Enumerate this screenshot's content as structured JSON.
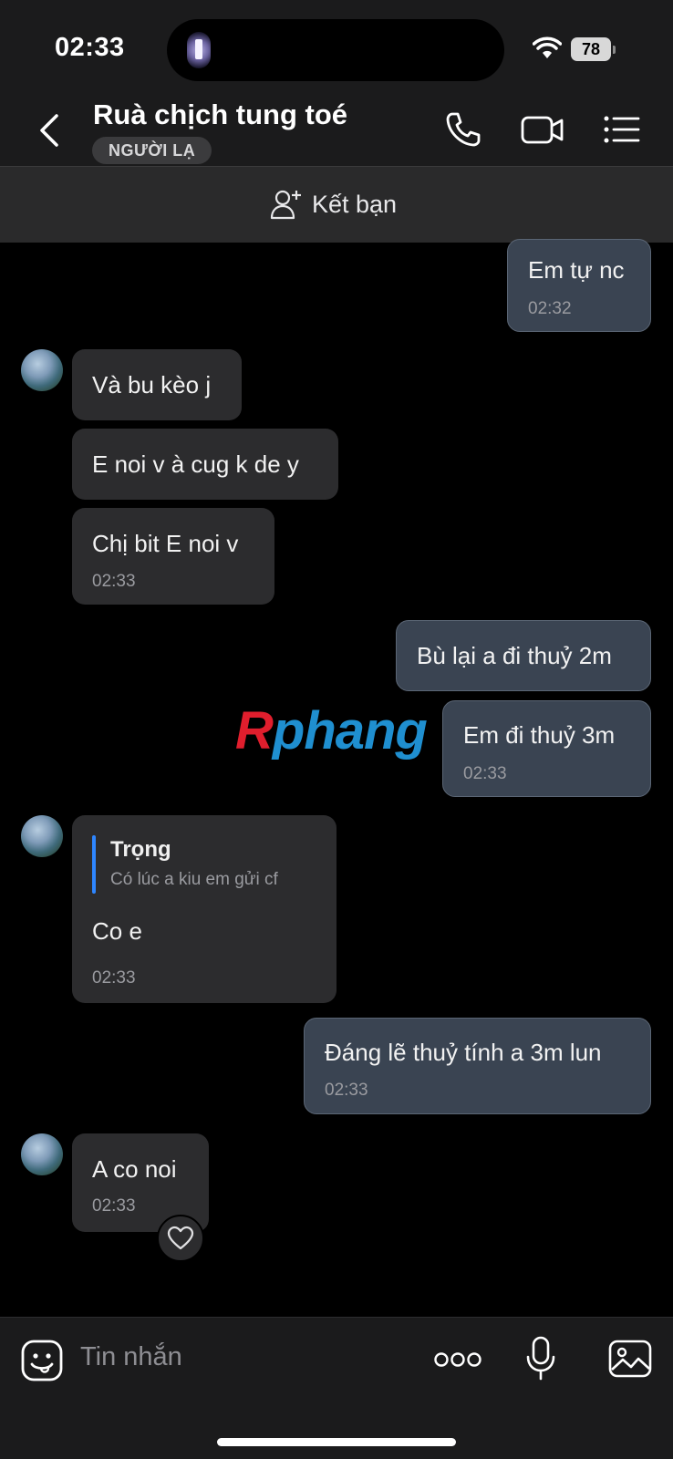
{
  "status_bar": {
    "time": "02:33",
    "battery": "78"
  },
  "header": {
    "title": "Ruà chịch tung toé",
    "badge": "NGƯỜI LẠ",
    "icons": [
      "back-icon",
      "phone-icon",
      "video-call-icon",
      "menu-list-icon"
    ]
  },
  "friend_bar": {
    "label": "Kết bạn",
    "icon": "add-friend-icon"
  },
  "messages": [
    {
      "side": "out",
      "text": "Em tự nc",
      "time": "02:32"
    },
    {
      "side": "in",
      "text": "Và bu kèo j"
    },
    {
      "side": "in",
      "text": "E noi v à cug k de y"
    },
    {
      "side": "in",
      "text": "Chị bit E noi v",
      "time": "02:33"
    },
    {
      "side": "out",
      "text": "Bù lại a đi thuỷ 2m"
    },
    {
      "side": "out",
      "text": "Em đi thuỷ 3m",
      "time": "02:33"
    },
    {
      "side": "in",
      "reply_to": {
        "name": "Trọng",
        "text": "Có lúc a kiu em gửi cf"
      },
      "text": "Co e",
      "time": "02:33"
    },
    {
      "side": "out",
      "text": "Đáng lẽ thuỷ tính a 3m lun",
      "time": "02:33"
    },
    {
      "side": "in",
      "text": "A co noi",
      "time": "02:33",
      "reaction": "heart-icon"
    }
  ],
  "watermark": {
    "first": "R",
    "rest": "phang"
  },
  "composer": {
    "placeholder": "Tin nhắn",
    "icons": [
      "sticker-icon",
      "more-icon",
      "microphone-icon",
      "image-icon"
    ]
  },
  "colors": {
    "incoming": "#2c2c2e",
    "outgoing": "#3a4452",
    "accent": "#2e86ff"
  }
}
